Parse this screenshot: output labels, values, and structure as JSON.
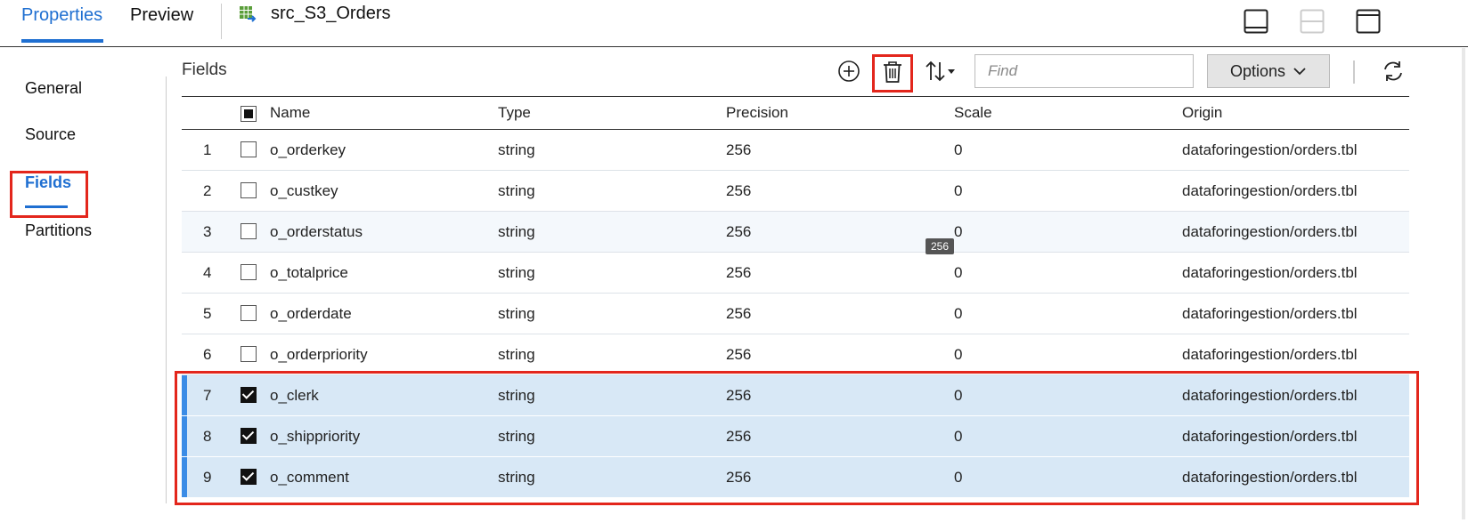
{
  "tabs": {
    "properties": "Properties",
    "preview": "Preview",
    "object_name": "src_S3_Orders"
  },
  "sidenav": {
    "items": [
      {
        "label": "General"
      },
      {
        "label": "Source"
      },
      {
        "label": "Fields"
      },
      {
        "label": "Partitions"
      }
    ],
    "active": "Fields"
  },
  "fields_panel": {
    "title": "Fields",
    "find_placeholder": "Find",
    "options_label": "Options",
    "icons": {
      "add": "plus-circle-icon",
      "delete": "trash-icon",
      "sort": "sort-arrows-icon",
      "refresh": "refresh-icon"
    }
  },
  "table": {
    "headers": {
      "name": "Name",
      "type": "Type",
      "precision": "Precision",
      "scale": "Scale",
      "origin": "Origin"
    },
    "rows": [
      {
        "num": "1",
        "name": "o_orderkey",
        "type": "string",
        "precision": "256",
        "scale": "0",
        "origin": "dataforingestion/orders.tbl",
        "checked": false
      },
      {
        "num": "2",
        "name": "o_custkey",
        "type": "string",
        "precision": "256",
        "scale": "0",
        "origin": "dataforingestion/orders.tbl",
        "checked": false
      },
      {
        "num": "3",
        "name": "o_orderstatus",
        "type": "string",
        "precision": "256",
        "scale": "0",
        "origin": "dataforingestion/orders.tbl",
        "checked": false
      },
      {
        "num": "4",
        "name": "o_totalprice",
        "type": "string",
        "precision": "256",
        "scale": "0",
        "origin": "dataforingestion/orders.tbl",
        "checked": false
      },
      {
        "num": "5",
        "name": "o_orderdate",
        "type": "string",
        "precision": "256",
        "scale": "0",
        "origin": "dataforingestion/orders.tbl",
        "checked": false
      },
      {
        "num": "6",
        "name": "o_orderpriority",
        "type": "string",
        "precision": "256",
        "scale": "0",
        "origin": "dataforingestion/orders.tbl",
        "checked": false
      },
      {
        "num": "7",
        "name": "o_clerk",
        "type": "string",
        "precision": "256",
        "scale": "0",
        "origin": "dataforingestion/orders.tbl",
        "checked": true
      },
      {
        "num": "8",
        "name": "o_shippriority",
        "type": "string",
        "precision": "256",
        "scale": "0",
        "origin": "dataforingestion/orders.tbl",
        "checked": true
      },
      {
        "num": "9",
        "name": "o_comment",
        "type": "string",
        "precision": "256",
        "scale": "0",
        "origin": "dataforingestion/orders.tbl",
        "checked": true
      }
    ],
    "tooltip": "256"
  },
  "colors": {
    "accent": "#1f6fd1",
    "highlight": "#e3261c",
    "selected_row": "#d8e8f6"
  }
}
